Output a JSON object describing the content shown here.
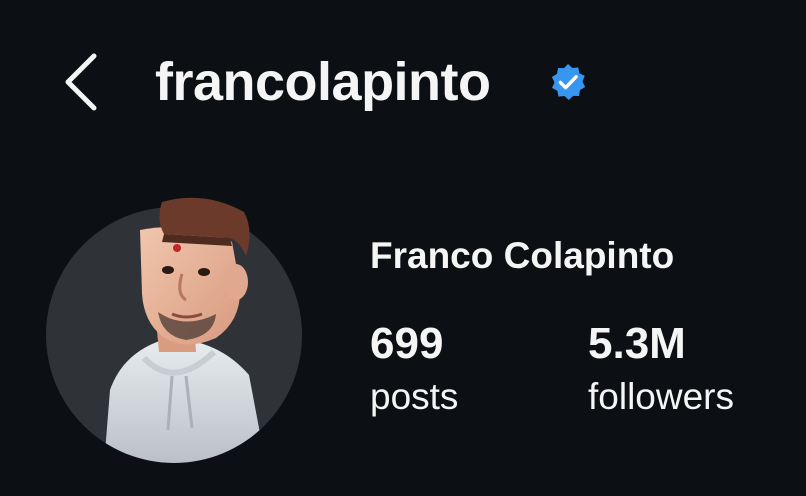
{
  "header": {
    "username": "francolapinto",
    "back_icon": "chevron-left-icon",
    "verified_icon": "verified-badge-icon",
    "verified_color": "#3797f0"
  },
  "profile": {
    "display_name": "Franco Colapinto",
    "avatar_icon": "avatar-3d-character"
  },
  "stats": [
    {
      "value": "699",
      "label": "posts"
    },
    {
      "value": "5.3M",
      "label": "followers"
    }
  ],
  "colors": {
    "background": "#0c1014",
    "text": "#f5f5f5",
    "avatar_bg": "#2f3338"
  }
}
